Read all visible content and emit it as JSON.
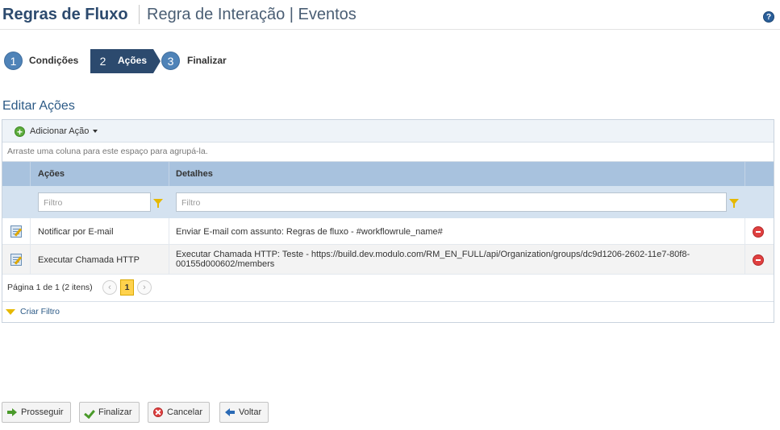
{
  "header": {
    "title": "Regras de Fluxo",
    "subtitle": "Regra de Interação | Eventos",
    "help_glyph": "?"
  },
  "wizard": {
    "steps": [
      {
        "number": "1",
        "label": "Condições",
        "active": false
      },
      {
        "number": "2",
        "label": "Ações",
        "active": true
      },
      {
        "number": "3",
        "label": "Finalizar",
        "active": false
      }
    ]
  },
  "section": {
    "title": "Editar Ações"
  },
  "grid": {
    "toolbar": {
      "add_action_label": "Adicionar Ação"
    },
    "group_hint": "Arraste uma coluna para este espaço para agrupá-la.",
    "columns": [
      "Ações",
      "Detalhes"
    ],
    "filter_placeholder": "Filtro",
    "rows": [
      {
        "action": "Notificar por E-mail",
        "details": "Enviar E-mail com assunto: Regras de fluxo - #workflowrule_name#"
      },
      {
        "action": "Executar Chamada HTTP",
        "details": "Executar Chamada HTTP: Teste - https://build.dev.modulo.com/RM_EN_FULL/api/Organization/groups/dc9d1206-2602-11e7-80f8-00155d000602/members"
      }
    ],
    "pager": {
      "summary": "Página 1 de 1 (2 itens)",
      "current_page": "1",
      "prev_glyph": "‹",
      "next_glyph": "›"
    },
    "create_filter_label": "Criar Filtro"
  },
  "footer": {
    "buttons": {
      "proceed": "Prosseguir",
      "finish": "Finalizar",
      "cancel": "Cancelar",
      "back": "Voltar"
    }
  },
  "colors": {
    "brand_navy": "#2c4a6e",
    "step_blue": "#4f83b8",
    "header_row": "#a8c2de",
    "filter_row": "#d4e2f0",
    "page_highlight": "#ffd24d"
  },
  "icons": [
    "help-icon",
    "add-icon",
    "chevron-down-icon",
    "filter-icon",
    "edit-icon",
    "delete-icon",
    "arrow-right-icon",
    "check-icon",
    "cancel-icon",
    "arrow-left-icon"
  ]
}
